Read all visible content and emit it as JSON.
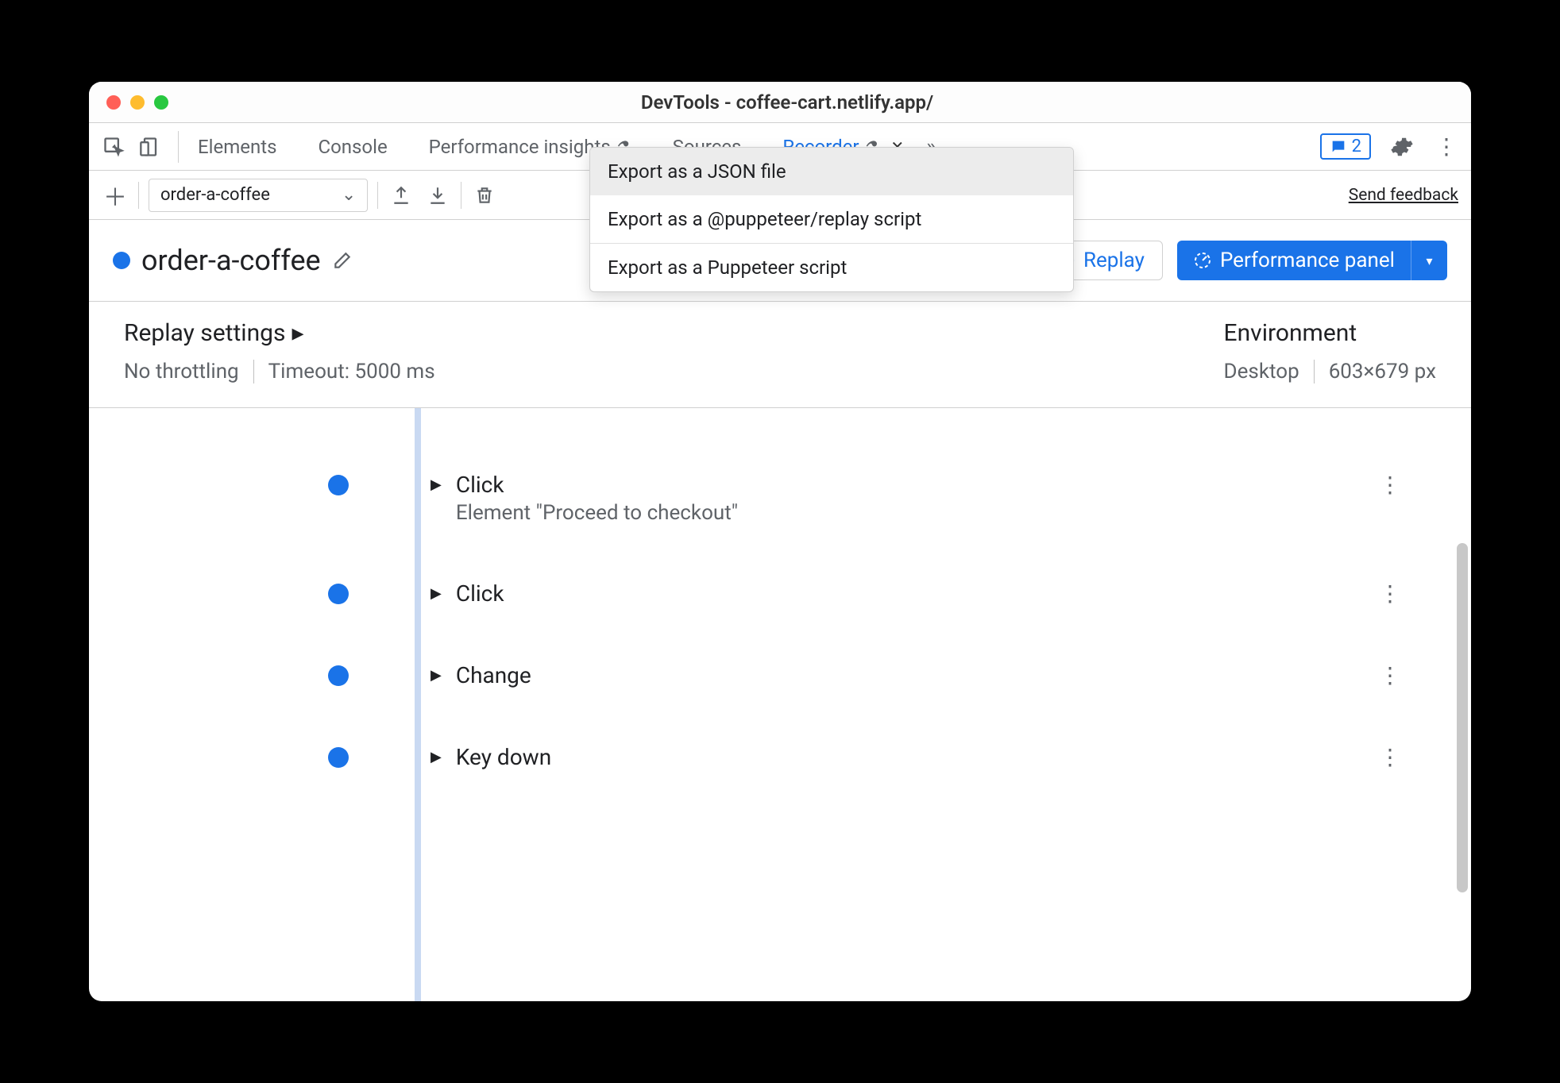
{
  "window": {
    "title": "DevTools - coffee-cart.netlify.app/"
  },
  "tabs": {
    "items": [
      {
        "label": "Elements",
        "active": false,
        "flask": false,
        "closeable": false
      },
      {
        "label": "Console",
        "active": false,
        "flask": false,
        "closeable": false
      },
      {
        "label": "Performance insights",
        "active": false,
        "flask": true,
        "closeable": false
      },
      {
        "label": "Sources",
        "active": false,
        "flask": false,
        "closeable": false
      },
      {
        "label": "Recorder",
        "active": true,
        "flask": true,
        "closeable": true
      }
    ],
    "chat_count": "2"
  },
  "toolbar": {
    "recording_name": "order-a-coffee",
    "send_feedback": "Send feedback"
  },
  "export_menu": {
    "items": [
      "Export as a JSON file",
      "Export as a @puppeteer/replay script",
      "Export as a Puppeteer script"
    ]
  },
  "header": {
    "title": "order-a-coffee",
    "replay_label": "Replay",
    "perf_label": "Performance panel"
  },
  "settings": {
    "replay_heading": "Replay settings",
    "throttling": "No throttling",
    "timeout": "Timeout: 5000 ms",
    "env_heading": "Environment",
    "device": "Desktop",
    "viewport": "603×679 px"
  },
  "steps": [
    {
      "title": "Click",
      "sub": "Element \"Proceed to checkout\""
    },
    {
      "title": "Click",
      "sub": ""
    },
    {
      "title": "Change",
      "sub": ""
    },
    {
      "title": "Key down",
      "sub": ""
    }
  ]
}
